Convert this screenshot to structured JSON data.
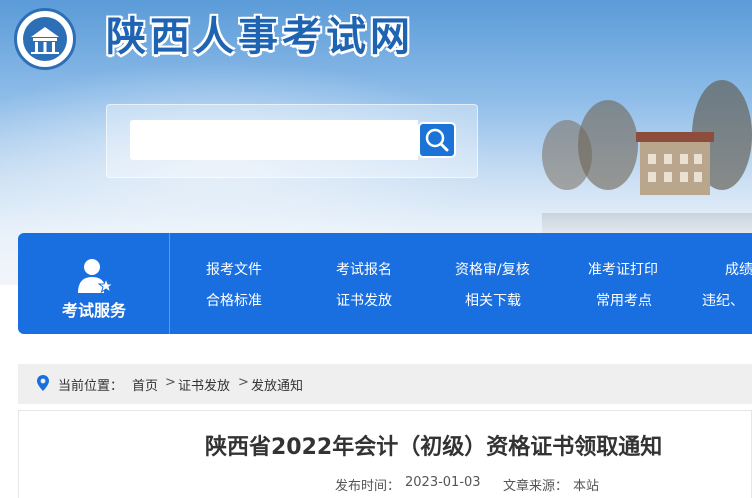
{
  "header": {
    "site_title": "陕西人事考试网",
    "logo": "shaanxi-gate-logo"
  },
  "search": {
    "placeholder": "",
    "button_icon": "magnifier-icon"
  },
  "nav": {
    "service_label": "考试服务",
    "service_icon": "person-star-icon",
    "row1": [
      "报考文件",
      "考试报名",
      "资格审/复核",
      "准考证打印",
      "成绩"
    ],
    "row2": [
      "合格标准",
      "证书发放",
      "相关下载",
      "常用考点",
      "违纪、"
    ]
  },
  "breadcrumb": {
    "prefix": "当前位置：",
    "items": [
      "首页",
      "证书发放",
      "发放通知"
    ],
    "separator": ">"
  },
  "article": {
    "title": "陕西省2022年会计（初级）资格证书领取通知",
    "publish_label": "发布时间：",
    "publish_date": "2023-01-03",
    "source_label": "文章来源：",
    "source": "本站"
  },
  "colors": {
    "nav_bg": "#1a6fe0",
    "title_blue": "#1f63b3",
    "search_button": "#1b73d6"
  }
}
